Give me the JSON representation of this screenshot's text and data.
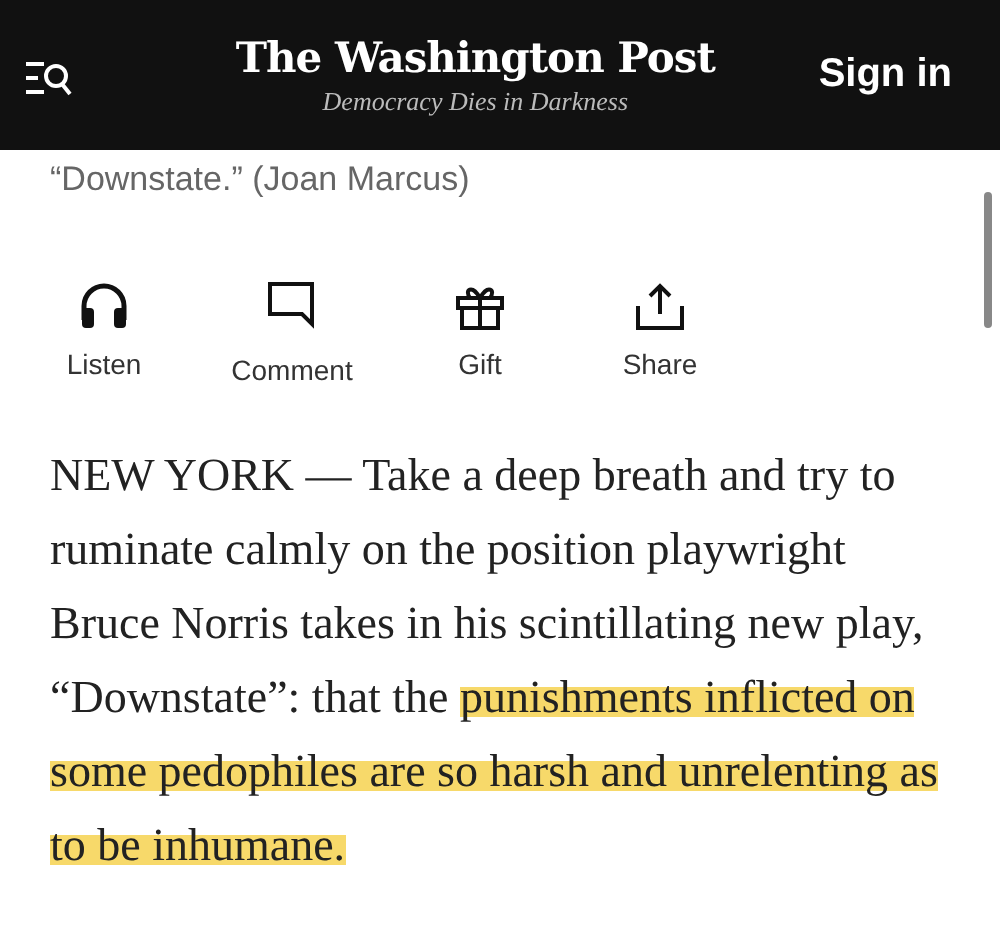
{
  "header": {
    "logo": "The Washington Post",
    "tagline": "Democracy Dies in Darkness",
    "sign_in": "Sign in"
  },
  "caption": "“Downstate.” (Joan Marcus)",
  "actions": [
    {
      "kind": "listen",
      "label": "Listen"
    },
    {
      "kind": "comment",
      "label": "Comment"
    },
    {
      "kind": "gift",
      "label": "Gift"
    },
    {
      "kind": "share",
      "label": "Share"
    }
  ],
  "paragraph": [
    {
      "text": "NEW YORK — Take a deep breath and try to ruminate calmly on the position playwright Bruce Norris takes in his scintillating new play, “Downstate”: that the ",
      "highlighted": false
    },
    {
      "text": "punishments inflicted on some pedophiles are so harsh and unrelenting as to be inhumane.",
      "highlighted": true
    }
  ]
}
